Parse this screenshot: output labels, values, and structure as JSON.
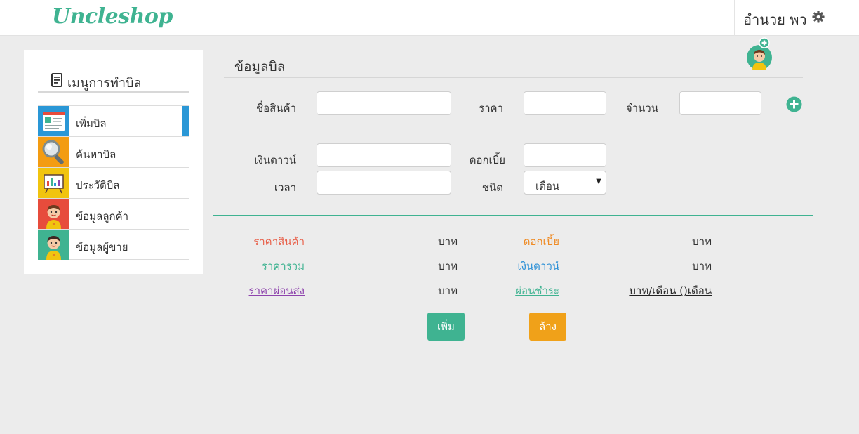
{
  "header": {
    "logo": "Uncleshop",
    "user_name": "อำนวย พว",
    "settings_icon": "gear-icon"
  },
  "sidebar": {
    "title": "เมนูการทำบิล",
    "title_icon": "document-icon",
    "items": [
      {
        "label": "เพิ่มบิล",
        "icon": "bill-form-icon",
        "color": "#2a97d6",
        "active": true
      },
      {
        "label": "ค้นหาบิล",
        "icon": "magnifier-icon",
        "color": "#f39c12",
        "active": false
      },
      {
        "label": "ประวัติบิล",
        "icon": "chart-board-icon",
        "color": "#f1c40f",
        "active": false
      },
      {
        "label": "ข้อมูลลูกค้า",
        "icon": "customer-avatar-icon",
        "color": "#e74c3c",
        "active": false
      },
      {
        "label": "ข้อมูลผู้ขาย",
        "icon": "seller-avatar-icon",
        "color": "#3fb391",
        "active": false
      }
    ]
  },
  "form": {
    "section_title": "ข้อมูลบิล",
    "product_name_label": "ชื่อสินค้า",
    "product_name_value": "",
    "price_label": "ราคา",
    "price_value": "",
    "quantity_label": "จำนวน",
    "quantity_value": "",
    "down_payment_label": "เงินดาวน์",
    "down_payment_value": "",
    "interest_label": "ดอกเบี้ย",
    "interest_value": "",
    "period_label": "เวลา",
    "period_value": "",
    "type_label": "ชนิด",
    "type_selected": "เดือน"
  },
  "summary": {
    "product_price_label": "ราคาสินค้า",
    "product_price_unit": "บาท",
    "interest_label": "ดอกเบี้ย",
    "interest_unit": "บาท",
    "total_price_label": "ราคารวม",
    "total_price_unit": "บาท",
    "down_payment_label": "เงินดาวน์",
    "down_payment_unit": "บาท",
    "installment_price_label": "ราคาผ่อนส่ง",
    "installment_price_unit": "บาท",
    "payment_label": "ผ่อนชำระ",
    "payment_unit": "บาท/เดือน ()เดือน"
  },
  "actions": {
    "add_label": "เพิ่ม",
    "clear_label": "ล้าง"
  },
  "colors": {
    "accent": "#3fb391",
    "active": "#2a97d6",
    "clear": "#f0a119"
  }
}
